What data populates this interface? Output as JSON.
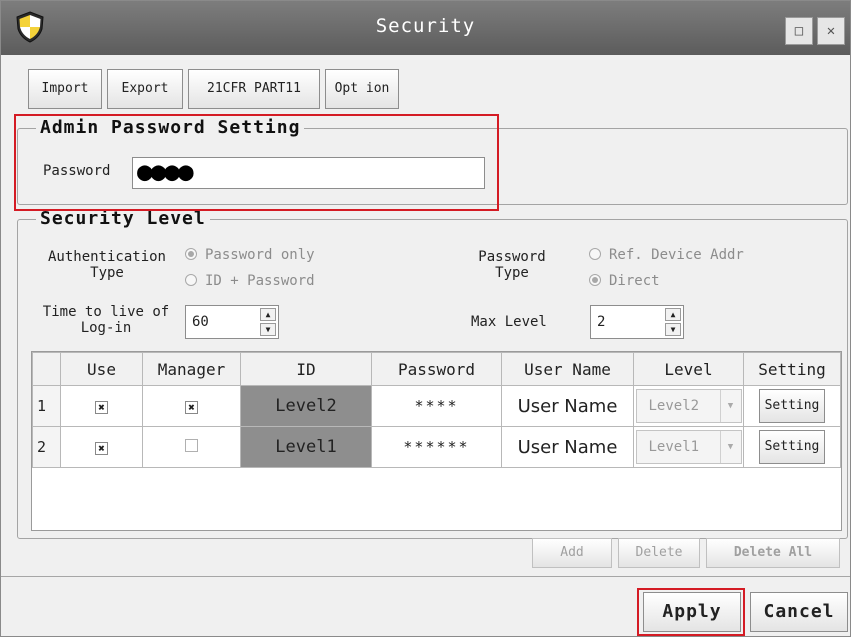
{
  "window": {
    "title": "Security"
  },
  "toolbar": {
    "import": "Import",
    "export": "Export",
    "cfr": "21CFR PART11",
    "option": "Opt ion"
  },
  "admin": {
    "legend": "Admin Password Setting",
    "password_label": "Password",
    "password_value": "●●●●"
  },
  "security": {
    "legend": "Security Level",
    "auth_type_label_1": "Authentication",
    "auth_type_label_2": "Type",
    "auth_opt_1": "Password only",
    "auth_opt_2": "ID + Password",
    "pw_type_label_1": "Password",
    "pw_type_label_2": "Type",
    "pw_opt_1": "Ref. Device Addr",
    "pw_opt_2": "Direct",
    "ttl_label_1": "Time to live of",
    "ttl_label_2": "Log-in",
    "ttl_value": "60",
    "max_level_label": "Max Level",
    "max_level_value": "2"
  },
  "table": {
    "headers": {
      "use": "Use",
      "manager": "Manager",
      "id": "ID",
      "password": "Password",
      "user_name": "User Name",
      "level": "Level",
      "setting": "Setting"
    },
    "rows": [
      {
        "num": "1",
        "id": "Level2",
        "password": "****",
        "user_name": "User Name",
        "level": "Level2",
        "setting": "Setting",
        "use": true,
        "manager": true
      },
      {
        "num": "2",
        "id": "Level1",
        "password": "******",
        "user_name": "User Name",
        "level": "Level1",
        "setting": "Setting",
        "use": true,
        "manager": false
      }
    ]
  },
  "actions": {
    "add": "Add",
    "delete": "Delete",
    "delete_all": "Delete All"
  },
  "footer": {
    "apply": "Apply",
    "cancel": "Cancel"
  },
  "colors": {
    "titlebar": "#6b6b6b",
    "highlight": "#d41b24",
    "id_cell": "#8e8e8e"
  }
}
